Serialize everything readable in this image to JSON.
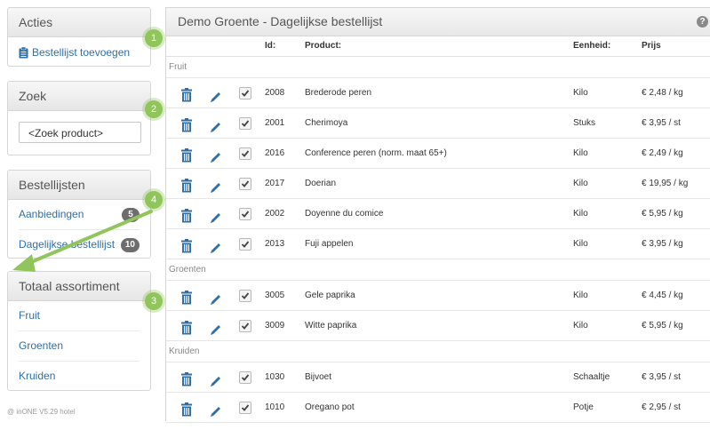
{
  "sidebar": {
    "acties": {
      "title": "Acties",
      "link": "Bestellijst toevoegen"
    },
    "zoek": {
      "title": "Zoek",
      "placeholder": "<Zoek product>"
    },
    "bestellijsten": {
      "title": "Bestellijsten",
      "items": [
        {
          "label": "Aanbiedingen",
          "count": "5"
        },
        {
          "label": "Dagelijkse bestellijst",
          "count": "10"
        }
      ]
    },
    "assortiment": {
      "title": "Totaal assortiment",
      "items": [
        {
          "label": "Fruit"
        },
        {
          "label": "Groenten"
        },
        {
          "label": "Kruiden"
        }
      ]
    }
  },
  "steps": [
    "1",
    "2",
    "4",
    "3"
  ],
  "main": {
    "title": "Demo Groente - Dagelijkse bestellijst",
    "help": "?",
    "columns": {
      "id": "Id:",
      "product": "Product:",
      "unit": "Eenheid:",
      "price": "Prijs"
    },
    "groups": [
      {
        "name": "Fruit",
        "rows": [
          {
            "id": "2008",
            "product": "Brederode peren",
            "unit": "Kilo",
            "price": "€ 2,48 / kg"
          },
          {
            "id": "2001",
            "product": "Cherimoya",
            "unit": "Stuks",
            "price": "€ 3,95 / st"
          },
          {
            "id": "2016",
            "product": "Conference peren (norm. maat 65+)",
            "unit": "Kilo",
            "price": "€ 2,49 / kg"
          },
          {
            "id": "2017",
            "product": "Doerian",
            "unit": "Kilo",
            "price": "€ 19,95 / kg"
          },
          {
            "id": "2002",
            "product": "Doyenne du comice",
            "unit": "Kilo",
            "price": "€ 5,95 / kg"
          },
          {
            "id": "2013",
            "product": "Fuji appelen",
            "unit": "Kilo",
            "price": "€ 3,95 / kg"
          }
        ]
      },
      {
        "name": "Groenten",
        "rows": [
          {
            "id": "3005",
            "product": "Gele paprika",
            "unit": "Kilo",
            "price": "€ 4,45 / kg"
          },
          {
            "id": "3009",
            "product": "Witte paprika",
            "unit": "Kilo",
            "price": "€ 5,95 / kg"
          }
        ]
      },
      {
        "name": "Kruiden",
        "rows": [
          {
            "id": "1030",
            "product": "Bijvoet",
            "unit": "Schaaltje",
            "price": "€ 3,95 / st"
          },
          {
            "id": "1010",
            "product": "Oregano pot",
            "unit": "Potje",
            "price": "€ 2,95 / st"
          }
        ]
      }
    ]
  },
  "footer": "@ inONE V5.29 hotel",
  "colors": {
    "accent_link": "#2e6fa8",
    "icon_blue": "#2f6ea6",
    "step_green": "#8fc55a",
    "badge": "#6d6d6d"
  },
  "icons": {
    "list": "clipboard-icon",
    "delete": "trash-icon",
    "edit": "pencil-icon",
    "select": "checkbox-icon"
  }
}
